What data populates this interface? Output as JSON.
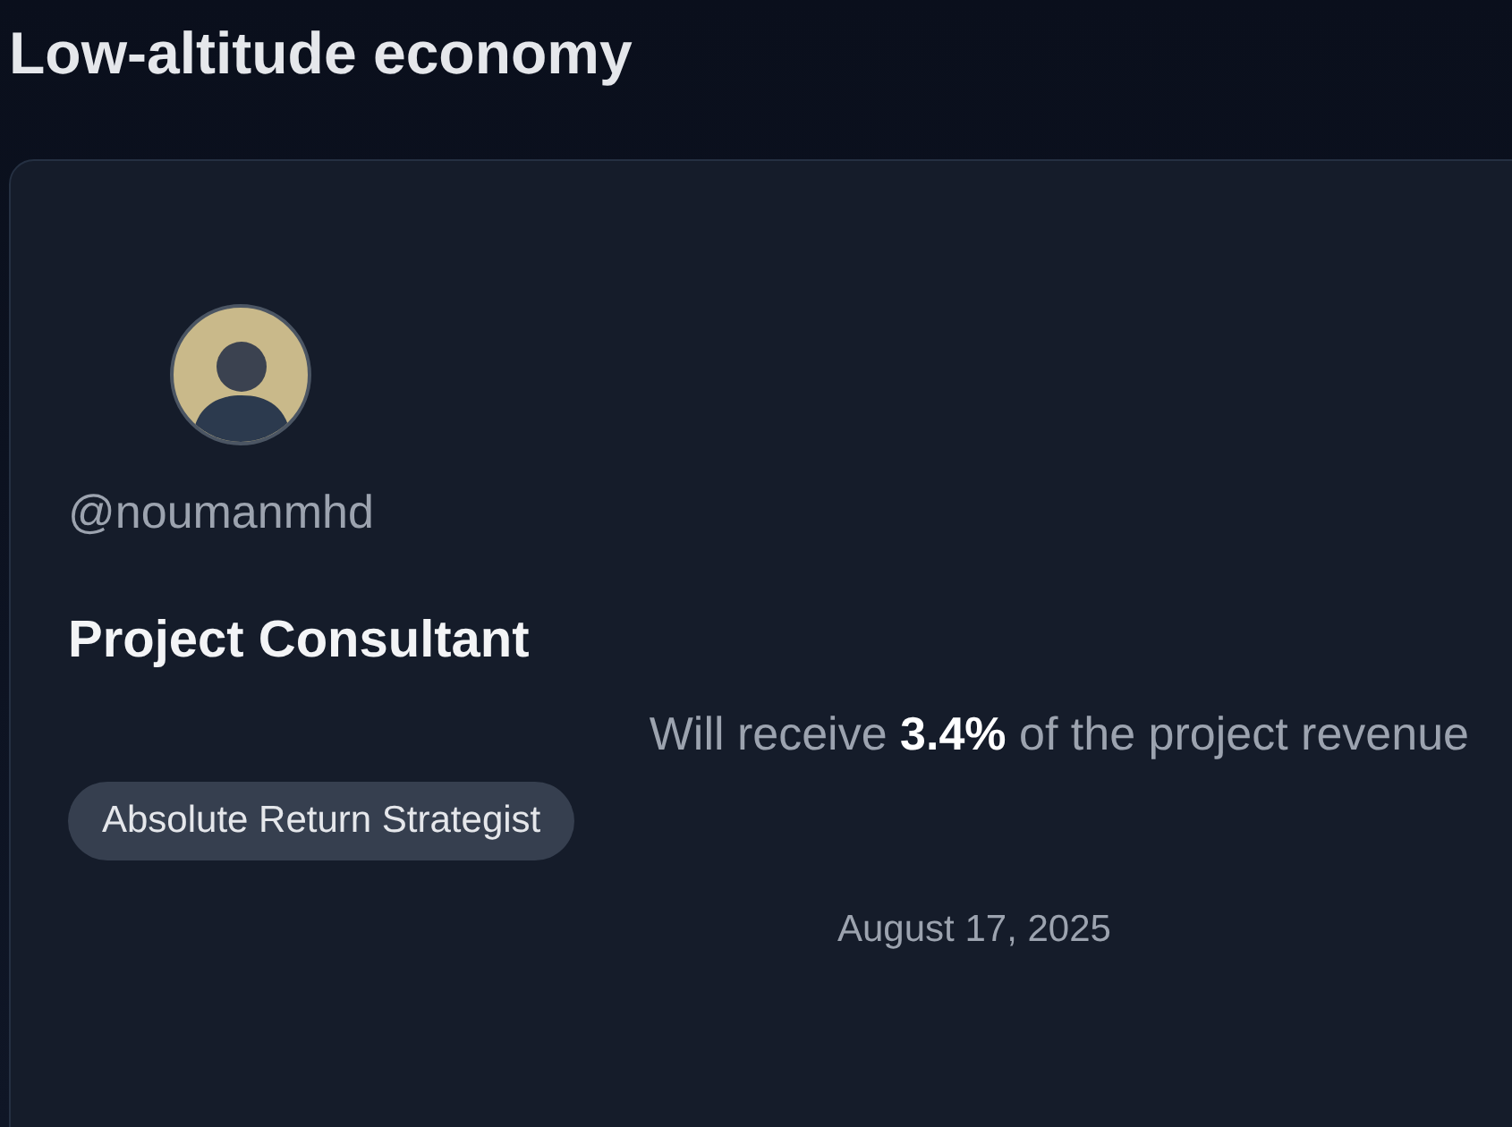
{
  "page": {
    "title": "Low-altitude economy"
  },
  "card": {
    "handle": "@noumanmhd",
    "role": "Project Consultant",
    "revenue_note": "Will receive **3.4%** of the project revenue",
    "tag": "Absolute Return Strategist",
    "date": "August 17, 2025"
  }
}
